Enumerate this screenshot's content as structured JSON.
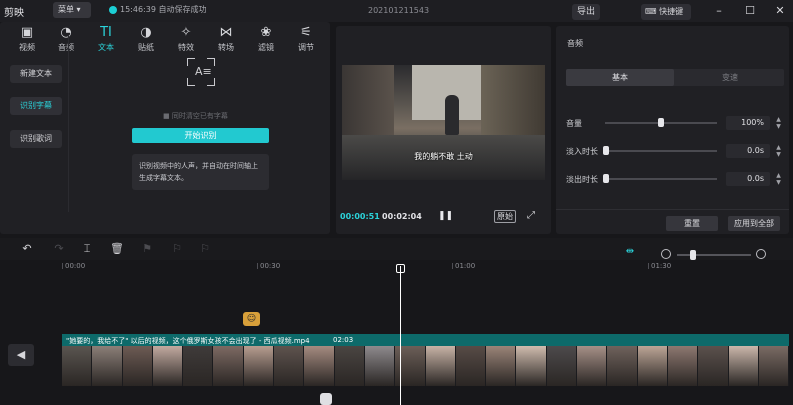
{
  "app": {
    "name": "剪映",
    "menu_label": "菜单",
    "status": "15:46:39 自动保存成功",
    "project": "202101211543",
    "export_label": "导出",
    "shortcut_label": "快捷键"
  },
  "toptabs": [
    {
      "icon": "video-icon",
      "label": "视频"
    },
    {
      "icon": "audio-icon",
      "label": "音频"
    },
    {
      "icon": "text-icon",
      "label": "文本"
    },
    {
      "icon": "sticker-icon",
      "label": "贴纸"
    },
    {
      "icon": "effects-icon",
      "label": "特效"
    },
    {
      "icon": "transition-icon",
      "label": "转场"
    },
    {
      "icon": "filter-icon",
      "label": "滤镜"
    },
    {
      "icon": "adjust-icon",
      "label": "调节"
    }
  ],
  "sidebar": {
    "items": [
      {
        "label": "新建文本"
      },
      {
        "label": "识别字幕"
      },
      {
        "label": "识别歌词"
      }
    ]
  },
  "recognize": {
    "checkbox_label": "同时清空已有字幕",
    "start_label": "开始识别",
    "description": "识别视频中的人声，并自动在时间轴上生成字幕文本。"
  },
  "player": {
    "subtitle": "我的躺不敢 土动",
    "current_time": "00:00:51",
    "total_time": "00:02:04",
    "original_label": "原始"
  },
  "audio": {
    "title": "音频",
    "tab_basic": "基本",
    "tab_speed": "变速",
    "volume_label": "音量",
    "volume_value": "100%",
    "volume_level": 0.5,
    "fade_in_label": "淡入时长",
    "fade_in_value": "0.0s",
    "fade_out_label": "淡出时长",
    "fade_out_value": "0.0s",
    "reset_label": "重置",
    "apply_all_label": "应用到全部"
  },
  "timeline": {
    "ticks": [
      "00:00",
      "00:30",
      "01:00",
      "01:30"
    ],
    "clip_name": "\"她要的，我给不了\"  以后的视频，这个俄罗斯女孩不会出现了 - 西瓜视频.mp4",
    "clip_duration": "02:03",
    "thumb_colors": [
      "#5a5550",
      "#8b7f78",
      "#6d5b54",
      "#c2aaa0",
      "#3f3b3a",
      "#7d6a63",
      "#b79d90",
      "#5e534e",
      "#a58b80",
      "#4a4542",
      "#8e8a8d",
      "#6c5f58",
      "#c8b3a6",
      "#574b46",
      "#9a8478",
      "#d0bcae",
      "#4d4a4c",
      "#a69087",
      "#6f625c",
      "#bca596",
      "#8d7870",
      "#5b514d",
      "#cbb7ab",
      "#7a6b64"
    ]
  }
}
